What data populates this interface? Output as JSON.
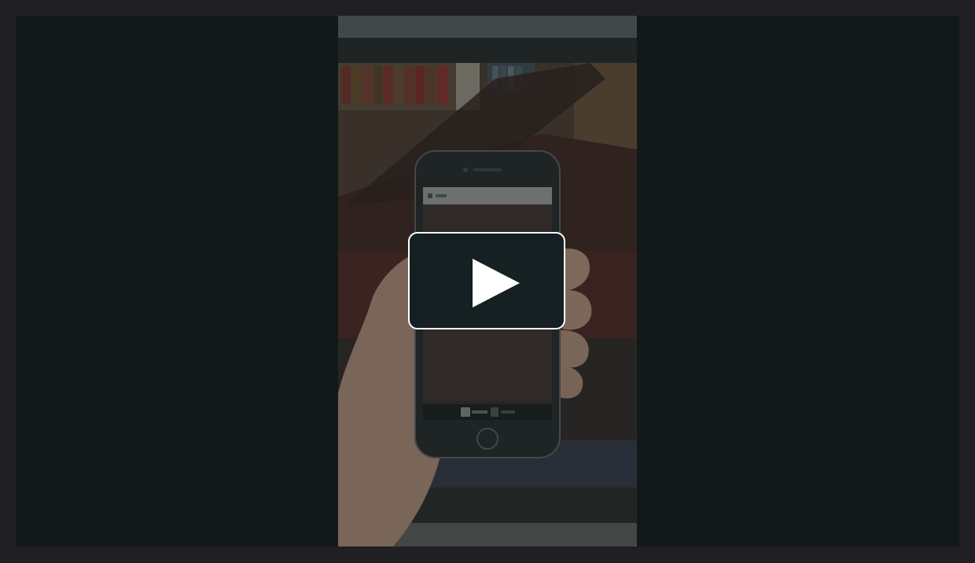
{
  "player": {
    "state": "paused",
    "play_icon": "play-icon",
    "accent_color": "#ffffff",
    "button_color": "#142021",
    "background_color": "#111919"
  },
  "video_thumbnail": {
    "description_icons": [
      "phone-mockup",
      "hand"
    ]
  }
}
